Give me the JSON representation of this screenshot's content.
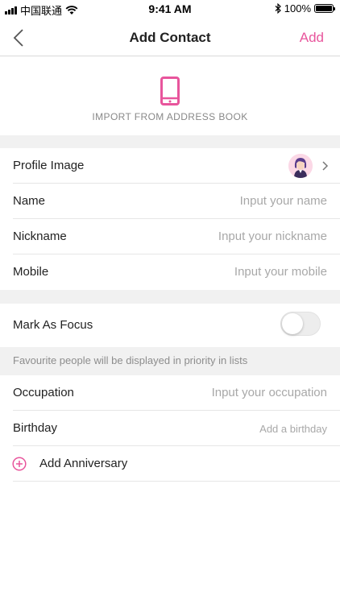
{
  "status_bar": {
    "carrier": "中国联通",
    "time": "9:41 AM",
    "battery": "100%",
    "battery_level": 1.0
  },
  "nav": {
    "back_icon": "chevron-left-icon",
    "title": "Add Contact",
    "action_label": "Add"
  },
  "import": {
    "icon": "phone-icon",
    "label": "IMPORT FROM ADDRESS BOOK"
  },
  "form": {
    "profile_image_label": "Profile Image",
    "name": {
      "label": "Name",
      "placeholder": "Input your name"
    },
    "nickname": {
      "label": "Nickname",
      "placeholder": "Input your nickname"
    },
    "mobile": {
      "label": "Mobile",
      "placeholder": "Input your mobile"
    },
    "focus": {
      "label": "Mark As Focus",
      "enabled": false
    },
    "focus_hint": "Favourite people will be displayed in priority in lists",
    "occupation": {
      "label": "Occupation",
      "placeholder": "Input your occupation"
    },
    "birthday": {
      "label": "Birthday",
      "placeholder": "Add a birthday"
    },
    "anniversary_label": "Add Anniversary"
  },
  "colors": {
    "accent": "#e8559c",
    "section_bg": "#f1f1f1",
    "placeholder": "#a8a8a8"
  }
}
